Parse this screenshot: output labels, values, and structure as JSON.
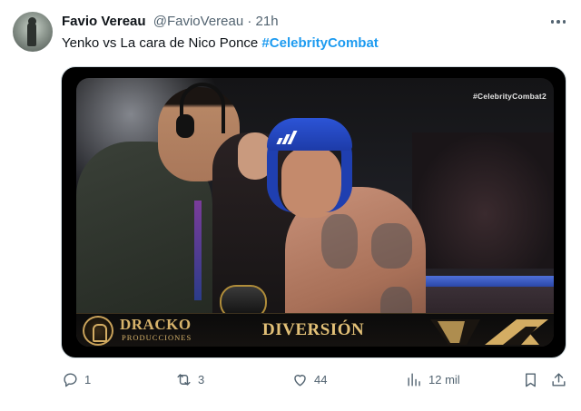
{
  "author": {
    "name": "Favio Vereau",
    "handle": "@FavioVereau",
    "separator": "·",
    "time": "21h"
  },
  "tweet": {
    "text": "Yenko vs La cara de Nico Ponce",
    "hashtag": "#CelebrityCombat"
  },
  "media": {
    "overlay_hashtag": "#CelebrityCombat2",
    "banner_brand_main": "DRACKO",
    "banner_brand_sub": "PRODUCCIONES",
    "banner_title": "DIVERSIÓN",
    "helmet_brand_icon": "adidas-stripes-icon"
  },
  "actions": {
    "reply_count": "1",
    "retweet_count": "3",
    "like_count": "44",
    "views_count": "12 mil"
  },
  "icons": [
    "more-icon",
    "reply-icon",
    "retweet-icon",
    "like-icon",
    "views-icon",
    "bookmark-icon",
    "share-icon"
  ],
  "colors": {
    "hashtag": "#1d9bf0",
    "text_secondary": "#536471",
    "banner_gold": "#d7b36b"
  }
}
